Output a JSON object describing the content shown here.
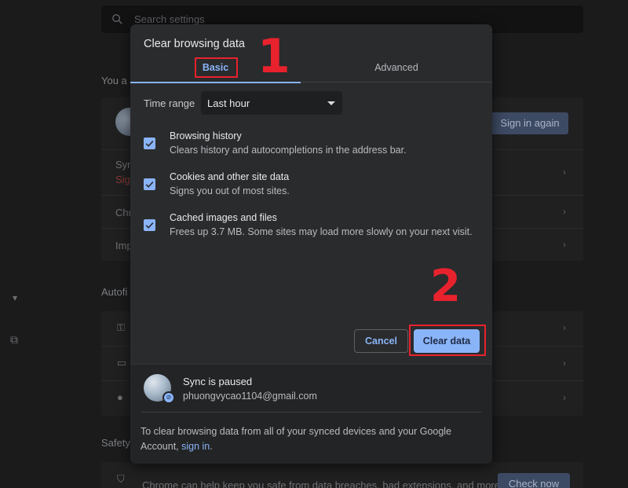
{
  "background": {
    "search_placeholder": "Search settings",
    "you_heading_partial": "You a",
    "sign_in_again_button": "Sign in again",
    "sync_row_partial": "Syn",
    "sync_row_sub_partial": "Sig",
    "chrome_row_partial": "Chr",
    "import_row_partial": "Imp",
    "autofill_heading_partial": "Autofi",
    "safety_heading_partial": "Safety",
    "safety_text": "Chrome can help keep you safe from data breaches, bad extensions, and more",
    "check_now_button": "Check now",
    "accent_color": "#8ab4f8"
  },
  "dialog": {
    "title": "Clear browsing data",
    "tabs": [
      {
        "label": "Basic",
        "selected": true
      },
      {
        "label": "Advanced",
        "selected": false
      }
    ],
    "time_range": {
      "label": "Time range",
      "value": "Last hour"
    },
    "options": [
      {
        "title": "Browsing history",
        "subtitle": "Clears history and autocompletions in the address bar.",
        "checked": true
      },
      {
        "title": "Cookies and other site data",
        "subtitle": "Signs you out of most sites.",
        "checked": true
      },
      {
        "title": "Cached images and files",
        "subtitle": "Frees up 3.7 MB. Some sites may load more slowly on your next visit.",
        "checked": true
      }
    ],
    "cancel_button": "Cancel",
    "clear_button": "Clear data",
    "sync": {
      "title": "Sync is paused",
      "email": "phuongvycao1104@gmail.com",
      "note_text": "To clear browsing data from all of your synced devices and your Google Account,",
      "note_link": "sign in",
      "note_end": "."
    }
  },
  "annotations": {
    "step1": "1",
    "step2": "2",
    "highlight_color": "#e8222d"
  }
}
